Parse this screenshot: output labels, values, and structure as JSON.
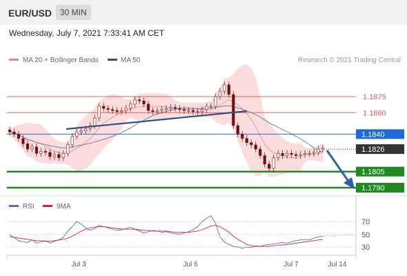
{
  "header": {
    "pair": "EUR/USD",
    "timeframe": "30 MIN"
  },
  "datetime": "Wednesday, July 7, 2021 7:33:41 AM CET",
  "legend": {
    "bollinger_label": "MA 20 + Bollinger Bands",
    "ma50_label": "MA 50",
    "copyright": "Research © 2021 Trading Central"
  },
  "colors": {
    "bollinger": "#f08080",
    "ma50": "#2b4e8c",
    "resistance": "#e06060",
    "pivot": "#1e6ad8",
    "support": "#1f8a1f",
    "last_price": "#333333",
    "rsi": "#4a72d8",
    "rsi_ma": "#e02020",
    "arrow": "#2d5fa8"
  },
  "levels": [
    {
      "value": 1.1875,
      "label": "1.1875",
      "kind": "resistance"
    },
    {
      "value": 1.186,
      "label": "1.1860",
      "kind": "resistance"
    },
    {
      "value": 1.184,
      "label": "1.1840",
      "kind": "pivot"
    },
    {
      "value": 1.1826,
      "label": "1.1826",
      "kind": "last"
    },
    {
      "value": 1.1805,
      "label": "1.1805",
      "kind": "support"
    },
    {
      "value": 1.179,
      "label": "1.1790",
      "kind": "support"
    }
  ],
  "rsi_panel": {
    "rsi_label": "RSI",
    "ma_label": "9MA",
    "ticks": [
      "70",
      "50",
      "30"
    ]
  },
  "x_axis": {
    "labels": [
      "Jul 3",
      "Jul 6",
      "Jul 7",
      "Jul 14"
    ]
  },
  "chart_data": {
    "type": "line",
    "title": "",
    "y_range_price": [
      1.1785,
      1.1895
    ],
    "y_range_rsi": [
      20,
      80
    ],
    "price_close": [
      1.1842,
      1.184,
      1.1836,
      1.1831,
      1.1826,
      1.1828,
      1.1822,
      1.1824,
      1.1823,
      1.1819,
      1.1821,
      1.1818,
      1.1822,
      1.183,
      1.1838,
      1.1842,
      1.1843,
      1.1845,
      1.1848,
      1.1855,
      1.1866,
      1.1864,
      1.1863,
      1.1862,
      1.1861,
      1.1862,
      1.1864,
      1.1868,
      1.1872,
      1.1871,
      1.1868,
      1.1862,
      1.1861,
      1.1862,
      1.1863,
      1.1864,
      1.1865,
      1.1864,
      1.1863,
      1.1862,
      1.1862,
      1.1861,
      1.1861,
      1.1863,
      1.1866,
      1.1866,
      1.1875,
      1.188,
      1.1886,
      1.1877,
      1.1848,
      1.184,
      1.1836,
      1.1832,
      1.183,
      1.1826,
      1.182,
      1.1812,
      1.1808,
      1.1818,
      1.1822,
      1.182,
      1.1822,
      1.1821,
      1.182,
      1.1821,
      1.1822,
      1.1822,
      1.1823,
      1.1826,
      1.1827
    ],
    "rsi": [
      49,
      45,
      40,
      38,
      37,
      41,
      36,
      38,
      40,
      36,
      39,
      41,
      45,
      55,
      62,
      70,
      66,
      60,
      56,
      59,
      64,
      62,
      60,
      58,
      56,
      57,
      59,
      61,
      58,
      55,
      52,
      54,
      56,
      55,
      53,
      54,
      52,
      51,
      50,
      52,
      54,
      57,
      62,
      70,
      75,
      79,
      68,
      46,
      38,
      34,
      31,
      30,
      28,
      30,
      29,
      32,
      31,
      33,
      34,
      35,
      36,
      37,
      36,
      38,
      40,
      41,
      42,
      41,
      44,
      46,
      47
    ],
    "rsi_ma": [
      46,
      45,
      44,
      43,
      42,
      41,
      40,
      40,
      39,
      39,
      40,
      41,
      42,
      44,
      47,
      51,
      55,
      58,
      60,
      61,
      62,
      62,
      61,
      60,
      59,
      58,
      58,
      58,
      58,
      57,
      56,
      56,
      55,
      55,
      55,
      55,
      54,
      53,
      53,
      53,
      53,
      54,
      55,
      57,
      60,
      63,
      64,
      62,
      58,
      53,
      47,
      42,
      38,
      34,
      32,
      31,
      31,
      31,
      31,
      32,
      33,
      33,
      34,
      35,
      36,
      37,
      38,
      39,
      40,
      41,
      42
    ]
  }
}
